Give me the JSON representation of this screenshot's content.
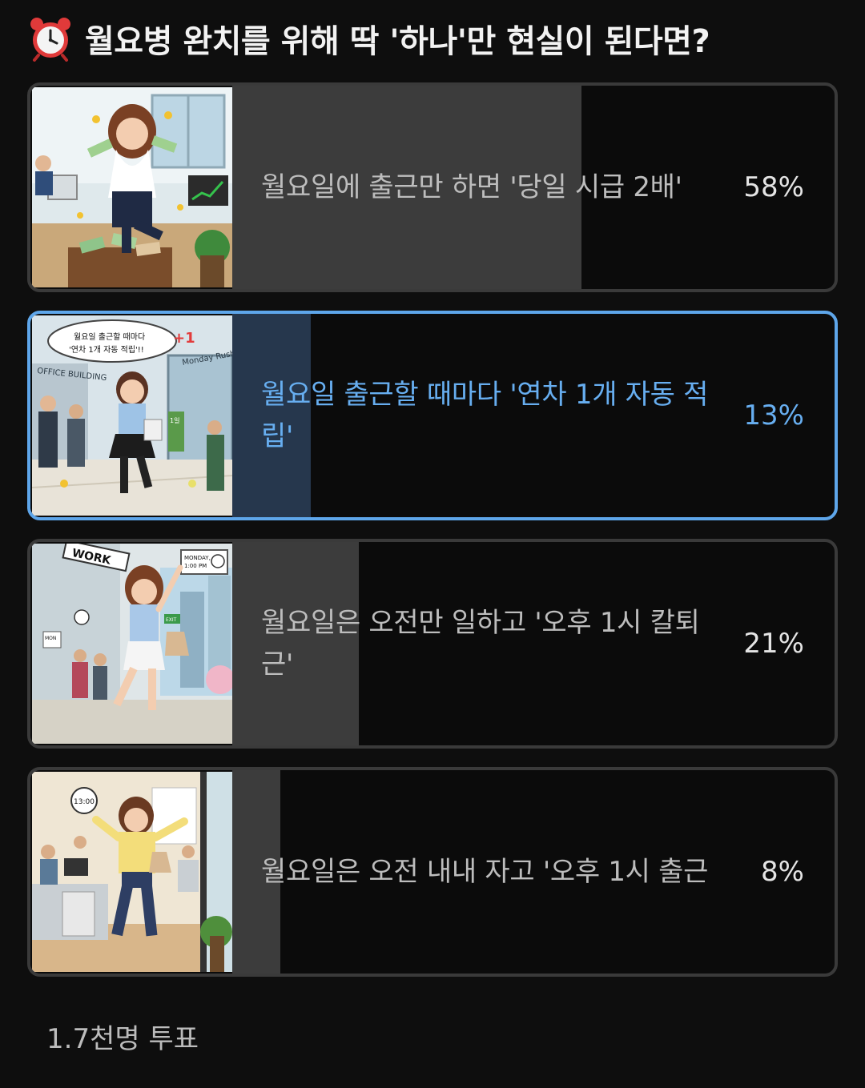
{
  "poll": {
    "title": "월요병 완치를 위해 딱 '하나'만 현실이 된다면?",
    "title_icon": "alarm-clock-icon",
    "vote_count": "1.7천명 투표",
    "colors": {
      "background": "#0e0e0e",
      "fill": "#3c3c3c",
      "selected_fill": "#26374d",
      "selected_accent": "#5ea6ea"
    },
    "options": [
      {
        "label": "월요일에 출근만 하면 '당일 시급 2배'",
        "percent_text": "58%",
        "percent": 58,
        "selected": false,
        "thumbnail": "money-celebration-illustration"
      },
      {
        "label": "월요일 출근할 때마다 '연차 1개 자동 적립'",
        "percent_text": "13%",
        "percent": 13,
        "selected": true,
        "thumbnail": "office-entrance-illustration",
        "thumbnail_texts": {
          "bubble_line1": "월요일 출근할 때마다",
          "bubble_line2": "'연차 1개 자동 적립'!!",
          "plus_one": "+1",
          "building_sign": "OFFICE BUILDING",
          "rush_sign": "Monday Rush",
          "badge": "1일"
        }
      },
      {
        "label": "월요일은 오전만 일하고 '오후 1시 칼퇴근'",
        "percent_text": "21%",
        "percent": 21,
        "selected": false,
        "thumbnail": "leaving-work-illustration",
        "thumbnail_texts": {
          "work_sign": "WORK",
          "clock_line1": "MONDAY,",
          "clock_line2": "1:00 PM",
          "mon_sign": "MON",
          "exit_sign": "EXIT"
        }
      },
      {
        "label": "월요일은 오전 내내 자고 '오후 1시 출근",
        "percent_text": "8%",
        "percent": 8,
        "selected": false,
        "thumbnail": "arriving-late-illustration",
        "thumbnail_texts": {
          "clock": "13:00"
        }
      }
    ]
  }
}
